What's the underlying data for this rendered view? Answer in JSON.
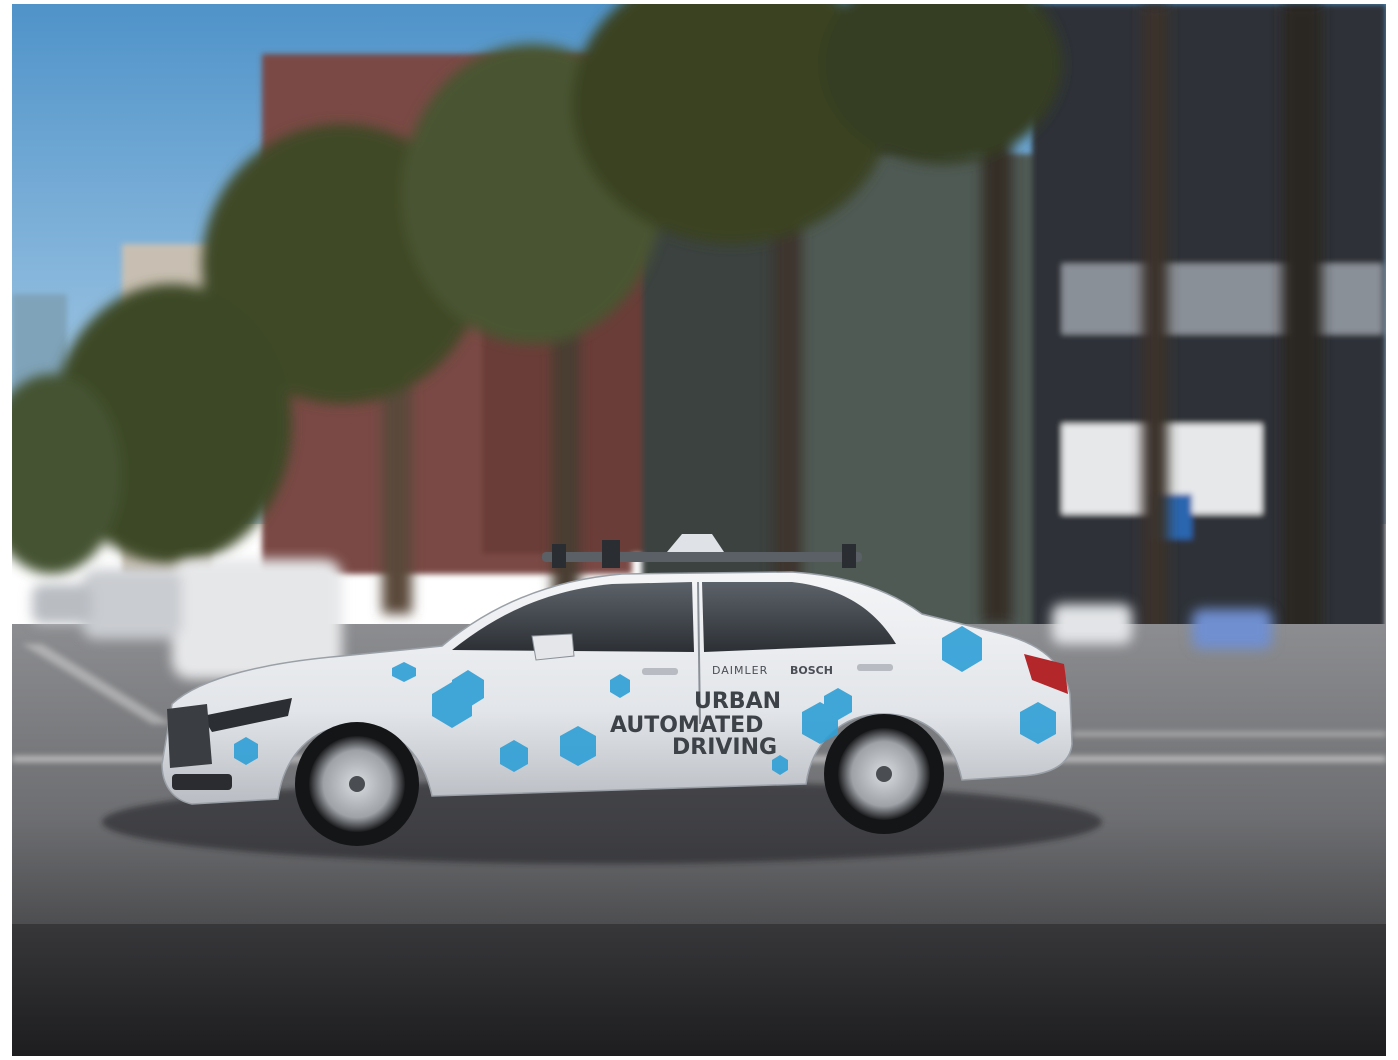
{
  "photo": {
    "colors": {
      "sky": "#5f9ecf",
      "sky_light": "#b9d6ec",
      "road": "#6e6f72",
      "road_dark": "#2a2a2c",
      "car_body": "#e9ebee",
      "hex_accent": "#2f9fd6",
      "building_brick": "#7a4a45",
      "palm_green": "#3f4a26",
      "grass": "#4d6b2a"
    },
    "vehicle": {
      "decal_line1": "URBAN",
      "decal_line2": "AUTOMATED",
      "decal_line3": "DRIVING",
      "sponsor_left": "DAIMLER",
      "sponsor_right": "BOSCH"
    }
  }
}
